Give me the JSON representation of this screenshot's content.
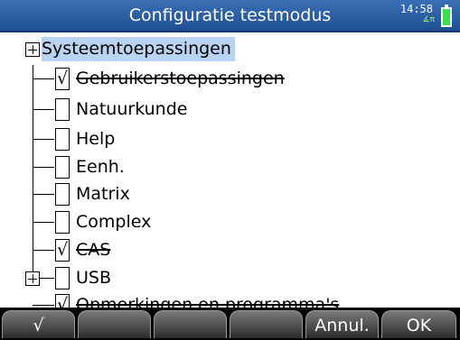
{
  "header": {
    "title": "Configuratie testmodus",
    "time": "14:58",
    "mode_indicator": "∡π",
    "battery_color": "#39e14a"
  },
  "tree": {
    "root": {
      "label": "Systeemtoepassingen",
      "expanded": false
    },
    "items": [
      {
        "label": "Gebruikerstoepassingen",
        "checked": true,
        "struck": true,
        "mark": "√"
      },
      {
        "label": "Natuurkunde",
        "checked": false,
        "struck": false,
        "mark": ""
      },
      {
        "label": "Help",
        "checked": false,
        "struck": false,
        "mark": ""
      },
      {
        "label": "Eenh.",
        "checked": false,
        "struck": false,
        "mark": ""
      },
      {
        "label": "Matrix",
        "checked": false,
        "struck": false,
        "mark": ""
      },
      {
        "label": "Complex",
        "checked": false,
        "struck": false,
        "mark": ""
      },
      {
        "label": "CAS",
        "checked": true,
        "struck": true,
        "mark": "√"
      },
      {
        "label": "USB",
        "checked": false,
        "struck": false,
        "mark": "",
        "has_children": true
      },
      {
        "label": "Opmerkingen en programma's",
        "checked": true,
        "struck": true,
        "mark": "√"
      }
    ]
  },
  "softkeys": [
    "√",
    "",
    "",
    "",
    "Annul.",
    "OK"
  ],
  "colors": {
    "title_bar": "#2a5ea3",
    "selection": "#b9d4f3"
  }
}
